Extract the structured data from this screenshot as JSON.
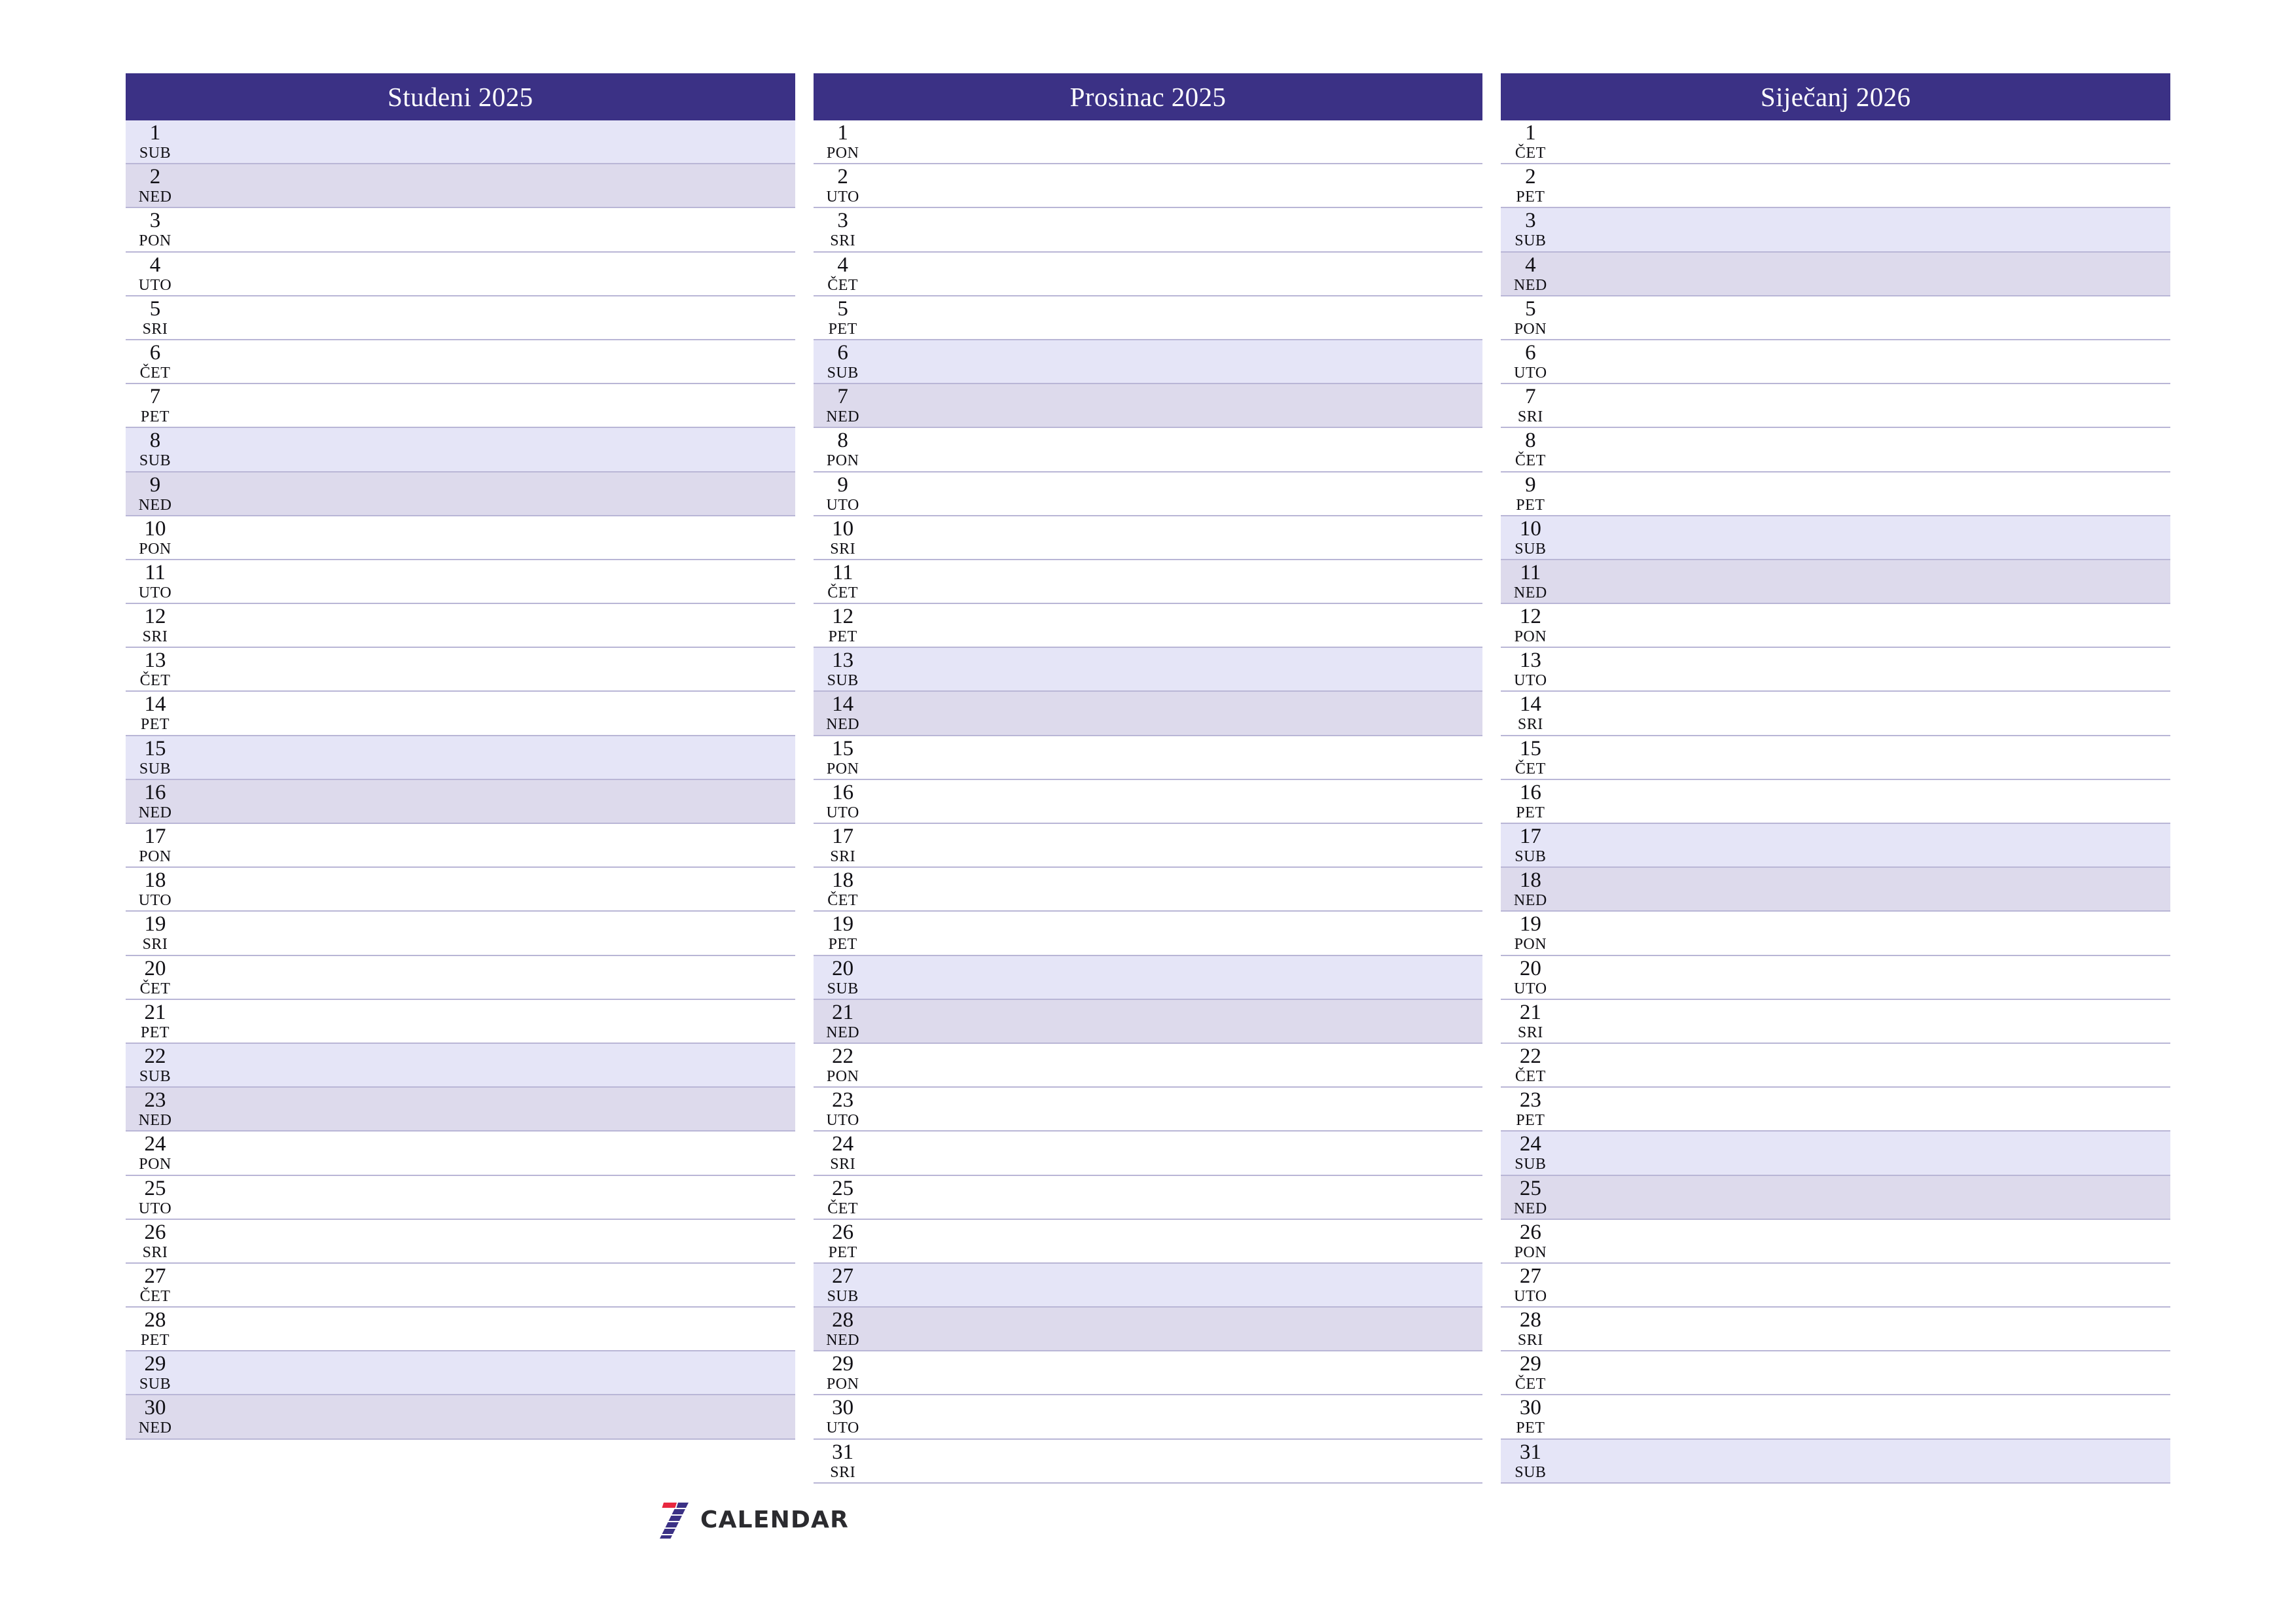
{
  "page": {
    "title": "Planer - Studeni 2025, Prosinac 2025, Siječanj 2026",
    "orientation": "landscape",
    "language": "hr"
  },
  "colors": {
    "header_bg": "#3b3185",
    "header_text": "#ffffff",
    "saturday_bg": "#e5e5f7",
    "sunday_bg": "#dddaec",
    "row_border": "#b9b6d6",
    "day_text": "#100f14",
    "logo_red": "#e8273f",
    "logo_blue": "#3b3185",
    "logo_text": "#2b2b2f"
  },
  "months": [
    {
      "title": "Studeni 2025",
      "days": [
        {
          "num": "1",
          "dow": "SUB",
          "type": "sat"
        },
        {
          "num": "2",
          "dow": "NED",
          "type": "sun"
        },
        {
          "num": "3",
          "dow": "PON",
          "type": "weekday"
        },
        {
          "num": "4",
          "dow": "UTO",
          "type": "weekday"
        },
        {
          "num": "5",
          "dow": "SRI",
          "type": "weekday"
        },
        {
          "num": "6",
          "dow": "ČET",
          "type": "weekday"
        },
        {
          "num": "7",
          "dow": "PET",
          "type": "weekday"
        },
        {
          "num": "8",
          "dow": "SUB",
          "type": "sat"
        },
        {
          "num": "9",
          "dow": "NED",
          "type": "sun"
        },
        {
          "num": "10",
          "dow": "PON",
          "type": "weekday"
        },
        {
          "num": "11",
          "dow": "UTO",
          "type": "weekday"
        },
        {
          "num": "12",
          "dow": "SRI",
          "type": "weekday"
        },
        {
          "num": "13",
          "dow": "ČET",
          "type": "weekday"
        },
        {
          "num": "14",
          "dow": "PET",
          "type": "weekday"
        },
        {
          "num": "15",
          "dow": "SUB",
          "type": "sat"
        },
        {
          "num": "16",
          "dow": "NED",
          "type": "sun"
        },
        {
          "num": "17",
          "dow": "PON",
          "type": "weekday"
        },
        {
          "num": "18",
          "dow": "UTO",
          "type": "weekday"
        },
        {
          "num": "19",
          "dow": "SRI",
          "type": "weekday"
        },
        {
          "num": "20",
          "dow": "ČET",
          "type": "weekday"
        },
        {
          "num": "21",
          "dow": "PET",
          "type": "weekday"
        },
        {
          "num": "22",
          "dow": "SUB",
          "type": "sat"
        },
        {
          "num": "23",
          "dow": "NED",
          "type": "sun"
        },
        {
          "num": "24",
          "dow": "PON",
          "type": "weekday"
        },
        {
          "num": "25",
          "dow": "UTO",
          "type": "weekday"
        },
        {
          "num": "26",
          "dow": "SRI",
          "type": "weekday"
        },
        {
          "num": "27",
          "dow": "ČET",
          "type": "weekday"
        },
        {
          "num": "28",
          "dow": "PET",
          "type": "weekday"
        },
        {
          "num": "29",
          "dow": "SUB",
          "type": "sat"
        },
        {
          "num": "30",
          "dow": "NED",
          "type": "sun"
        }
      ]
    },
    {
      "title": "Prosinac 2025",
      "days": [
        {
          "num": "1",
          "dow": "PON",
          "type": "weekday"
        },
        {
          "num": "2",
          "dow": "UTO",
          "type": "weekday"
        },
        {
          "num": "3",
          "dow": "SRI",
          "type": "weekday"
        },
        {
          "num": "4",
          "dow": "ČET",
          "type": "weekday"
        },
        {
          "num": "5",
          "dow": "PET",
          "type": "weekday"
        },
        {
          "num": "6",
          "dow": "SUB",
          "type": "sat"
        },
        {
          "num": "7",
          "dow": "NED",
          "type": "sun"
        },
        {
          "num": "8",
          "dow": "PON",
          "type": "weekday"
        },
        {
          "num": "9",
          "dow": "UTO",
          "type": "weekday"
        },
        {
          "num": "10",
          "dow": "SRI",
          "type": "weekday"
        },
        {
          "num": "11",
          "dow": "ČET",
          "type": "weekday"
        },
        {
          "num": "12",
          "dow": "PET",
          "type": "weekday"
        },
        {
          "num": "13",
          "dow": "SUB",
          "type": "sat"
        },
        {
          "num": "14",
          "dow": "NED",
          "type": "sun"
        },
        {
          "num": "15",
          "dow": "PON",
          "type": "weekday"
        },
        {
          "num": "16",
          "dow": "UTO",
          "type": "weekday"
        },
        {
          "num": "17",
          "dow": "SRI",
          "type": "weekday"
        },
        {
          "num": "18",
          "dow": "ČET",
          "type": "weekday"
        },
        {
          "num": "19",
          "dow": "PET",
          "type": "weekday"
        },
        {
          "num": "20",
          "dow": "SUB",
          "type": "sat"
        },
        {
          "num": "21",
          "dow": "NED",
          "type": "sun"
        },
        {
          "num": "22",
          "dow": "PON",
          "type": "weekday"
        },
        {
          "num": "23",
          "dow": "UTO",
          "type": "weekday"
        },
        {
          "num": "24",
          "dow": "SRI",
          "type": "weekday"
        },
        {
          "num": "25",
          "dow": "ČET",
          "type": "weekday"
        },
        {
          "num": "26",
          "dow": "PET",
          "type": "weekday"
        },
        {
          "num": "27",
          "dow": "SUB",
          "type": "sat"
        },
        {
          "num": "28",
          "dow": "NED",
          "type": "sun"
        },
        {
          "num": "29",
          "dow": "PON",
          "type": "weekday"
        },
        {
          "num": "30",
          "dow": "UTO",
          "type": "weekday"
        },
        {
          "num": "31",
          "dow": "SRI",
          "type": "weekday"
        }
      ]
    },
    {
      "title": "Siječanj 2026",
      "days": [
        {
          "num": "1",
          "dow": "ČET",
          "type": "weekday"
        },
        {
          "num": "2",
          "dow": "PET",
          "type": "weekday"
        },
        {
          "num": "3",
          "dow": "SUB",
          "type": "sat"
        },
        {
          "num": "4",
          "dow": "NED",
          "type": "sun"
        },
        {
          "num": "5",
          "dow": "PON",
          "type": "weekday"
        },
        {
          "num": "6",
          "dow": "UTO",
          "type": "weekday"
        },
        {
          "num": "7",
          "dow": "SRI",
          "type": "weekday"
        },
        {
          "num": "8",
          "dow": "ČET",
          "type": "weekday"
        },
        {
          "num": "9",
          "dow": "PET",
          "type": "weekday"
        },
        {
          "num": "10",
          "dow": "SUB",
          "type": "sat"
        },
        {
          "num": "11",
          "dow": "NED",
          "type": "sun"
        },
        {
          "num": "12",
          "dow": "PON",
          "type": "weekday"
        },
        {
          "num": "13",
          "dow": "UTO",
          "type": "weekday"
        },
        {
          "num": "14",
          "dow": "SRI",
          "type": "weekday"
        },
        {
          "num": "15",
          "dow": "ČET",
          "type": "weekday"
        },
        {
          "num": "16",
          "dow": "PET",
          "type": "weekday"
        },
        {
          "num": "17",
          "dow": "SUB",
          "type": "sat"
        },
        {
          "num": "18",
          "dow": "NED",
          "type": "sun"
        },
        {
          "num": "19",
          "dow": "PON",
          "type": "weekday"
        },
        {
          "num": "20",
          "dow": "UTO",
          "type": "weekday"
        },
        {
          "num": "21",
          "dow": "SRI",
          "type": "weekday"
        },
        {
          "num": "22",
          "dow": "ČET",
          "type": "weekday"
        },
        {
          "num": "23",
          "dow": "PET",
          "type": "weekday"
        },
        {
          "num": "24",
          "dow": "SUB",
          "type": "sat"
        },
        {
          "num": "25",
          "dow": "NED",
          "type": "sun"
        },
        {
          "num": "26",
          "dow": "PON",
          "type": "weekday"
        },
        {
          "num": "27",
          "dow": "UTO",
          "type": "weekday"
        },
        {
          "num": "28",
          "dow": "SRI",
          "type": "weekday"
        },
        {
          "num": "29",
          "dow": "ČET",
          "type": "weekday"
        },
        {
          "num": "30",
          "dow": "PET",
          "type": "weekday"
        },
        {
          "num": "31",
          "dow": "SUB",
          "type": "sat"
        }
      ]
    }
  ],
  "footer": {
    "logo_text": "CALENDAR",
    "logo_mark": "seven-stripes-icon"
  }
}
